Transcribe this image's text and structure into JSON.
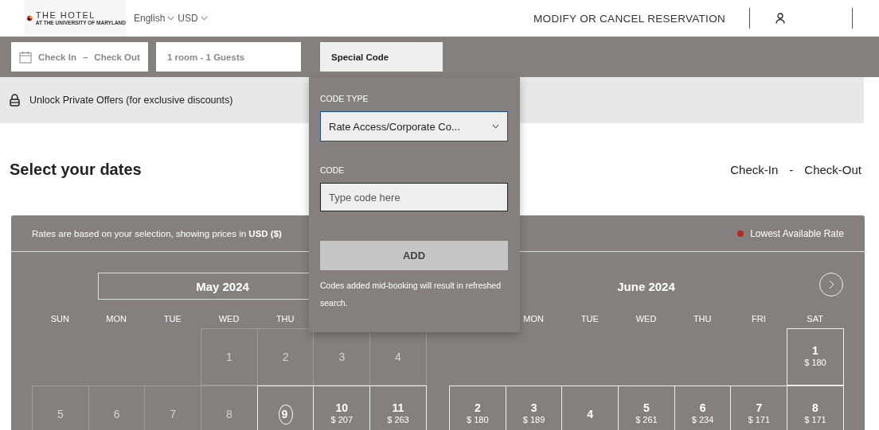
{
  "header": {
    "logo": {
      "title": "THE HOTEL",
      "subtitle": "AT THE UNIVERSITY OF MARYLAND"
    },
    "language": "English",
    "currency": "USD",
    "nav_link": "MODIFY OR CANCEL RESERVATION"
  },
  "search_bar": {
    "dates_field": {
      "check_in": "Check In",
      "separator": "–",
      "check_out": "Check Out"
    },
    "guests_field": "1 room - 1 Guests",
    "special_code_tab": {
      "label": "Special Code",
      "selected": true
    }
  },
  "unlock_banner": "Unlock Private Offers (for exclusive discounts)",
  "page_title": "Select your dates",
  "date_summary": {
    "check_in": "Check-In",
    "separator": "-",
    "check_out": "Check-Out"
  },
  "calendar": {
    "rates_note": "Rates are based on your selection, showing prices in **USD ($)**",
    "legend": {
      "label": "Lowest Available Rate",
      "color": "#b8281c"
    },
    "months": [
      {
        "title": "May 2024",
        "boxed": true,
        "weekdays": [
          {
            "kind": "label",
            "label": "SUN"
          },
          {
            "kind": "label",
            "label": "MON"
          },
          {
            "kind": "label",
            "label": "TUE"
          },
          {
            "kind": "label",
            "label": "WED"
          },
          {
            "kind": "label",
            "label": "THU"
          },
          {
            "kind": "covered"
          },
          {
            "kind": "covered"
          }
        ],
        "weeks": [
          [
            {
              "kind": "blank"
            },
            {
              "kind": "blank"
            },
            {
              "kind": "blank"
            },
            {
              "day": "1",
              "kind": "past",
              "today": false
            },
            {
              "day": "2",
              "kind": "past",
              "today": false
            },
            {
              "day": "3",
              "kind": "past",
              "today": false
            },
            {
              "day": "4",
              "kind": "past",
              "today": false
            }
          ],
          [
            {
              "day": "5",
              "kind": "past",
              "today": false
            },
            {
              "day": "6",
              "kind": "past",
              "today": false
            },
            {
              "day": "7",
              "kind": "past",
              "today": false
            },
            {
              "day": "8",
              "kind": "past",
              "today": false
            },
            {
              "day": "9",
              "kind": "available",
              "today": true
            },
            {
              "day": "10",
              "price": "$ 207",
              "kind": "available",
              "today": false
            },
            {
              "day": "11",
              "price": "$ 263",
              "kind": "available",
              "today": false
            }
          ]
        ]
      },
      {
        "title": "June 2024",
        "boxed": false,
        "next_button": true,
        "weekdays": [
          {
            "kind": "covered"
          },
          {
            "kind": "label",
            "label": "MON"
          },
          {
            "kind": "label",
            "label": "TUE"
          },
          {
            "kind": "label",
            "label": "WED"
          },
          {
            "kind": "label",
            "label": "THU"
          },
          {
            "kind": "label",
            "label": "FRI"
          },
          {
            "kind": "label",
            "label": "SAT"
          }
        ],
        "weeks": [
          [
            {
              "kind": "blank"
            },
            {
              "kind": "blank"
            },
            {
              "kind": "blank"
            },
            {
              "kind": "blank"
            },
            {
              "kind": "blank"
            },
            {
              "kind": "blank"
            },
            {
              "day": "1",
              "price": "$ 180",
              "kind": "available",
              "today": false
            }
          ],
          [
            {
              "day": "2",
              "price": "$ 180",
              "kind": "available",
              "today": false
            },
            {
              "day": "3",
              "price": "$ 189",
              "kind": "available",
              "today": false
            },
            {
              "day": "4",
              "kind": "available",
              "today": false
            },
            {
              "day": "5",
              "price": "$ 261",
              "kind": "available",
              "today": false
            },
            {
              "day": "6",
              "price": "$ 234",
              "kind": "available",
              "today": false
            },
            {
              "day": "7",
              "price": "$ 171",
              "kind": "available",
              "today": false
            },
            {
              "day": "8",
              "price": "$ 171",
              "kind": "available",
              "today": false
            }
          ]
        ]
      }
    ]
  },
  "special_code_popover": {
    "code_type_label": "CODE TYPE",
    "code_type_value": "Rate Access/Corporate Co...",
    "code_label": "CODE",
    "code_placeholder": "Type code here",
    "add_button": "ADD",
    "note": "Codes added mid-booking will result in refreshed search."
  }
}
